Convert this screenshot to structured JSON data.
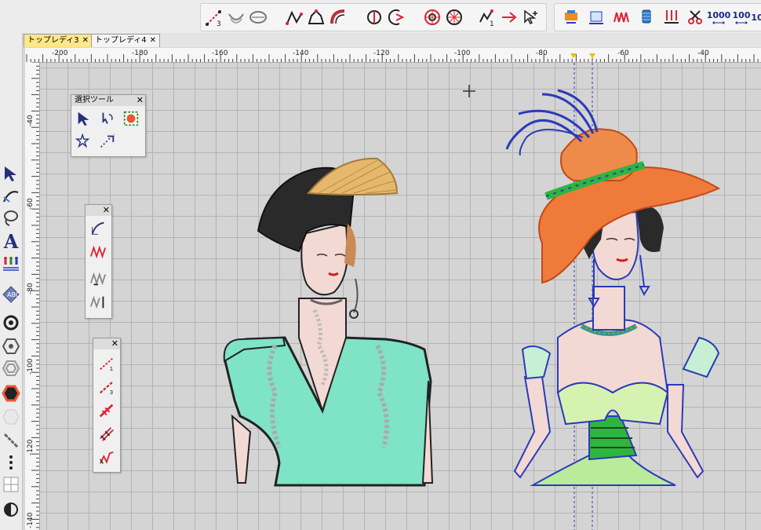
{
  "tabs": [
    {
      "label": "トップレディ3",
      "close": "✕",
      "active": true
    },
    {
      "label": "トップレディ4",
      "close": "✕",
      "active": false
    }
  ],
  "toolbar": {
    "stitch_counts": {
      "a": "1000",
      "b": "100",
      "c": "10"
    },
    "tool_numbers": {
      "n3": "3",
      "n1": "1"
    }
  },
  "left_tools": {
    "text_tool_glyph": "A"
  },
  "ruler": {
    "h_labels": [
      "-200",
      "-180",
      "-160",
      "-140",
      "-120",
      "-100",
      "-80",
      "-60",
      "-40"
    ],
    "v_labels": [
      "-40",
      "-60",
      "-80",
      "-100",
      "-120",
      "-140"
    ]
  },
  "palettes": {
    "select_tools": {
      "title": "選択ツール",
      "close": "✕"
    },
    "edit_tools": {
      "close": "✕"
    },
    "line_tools": {
      "close": "✕",
      "badge1": "1",
      "badge3": "3"
    }
  },
  "colors": {
    "accent_tab": "#ffe78a",
    "hat_orange": "#f07a3a",
    "dress_teal": "#7fe3c6",
    "outline_blue": "#2b3bb7",
    "dress_green": "#2fb53f"
  }
}
